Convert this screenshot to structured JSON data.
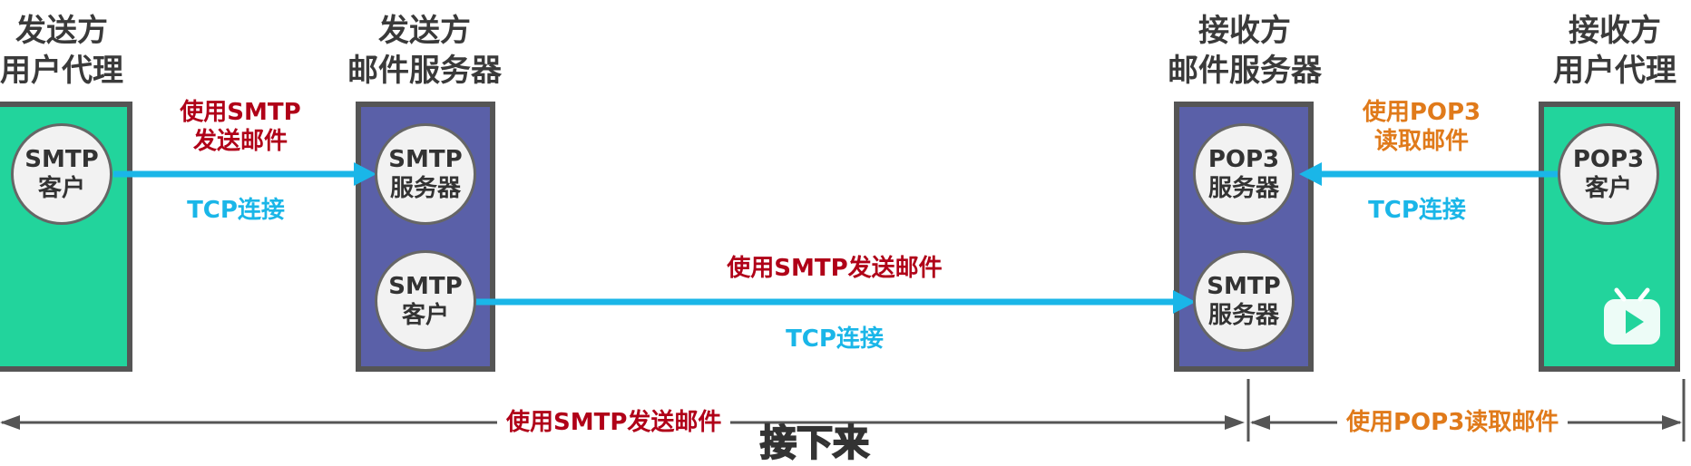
{
  "colors": {
    "agent_fill": "#22d49c",
    "server_fill": "#5a60a8",
    "arrow": "#1ab6e8",
    "smtp_text": "#b00018",
    "pop3_text": "#e07a1a"
  },
  "entities": {
    "sender_agent": {
      "line1": "发送方",
      "line2": "用户代理",
      "node": [
        "SMTP",
        "客户"
      ]
    },
    "sender_server": {
      "line1": "发送方",
      "line2": "邮件服务器",
      "node_top": [
        "SMTP",
        "服务器"
      ],
      "node_bottom": [
        "SMTP",
        "客户"
      ]
    },
    "receiver_server": {
      "line1": "接收方",
      "line2": "邮件服务器",
      "node_top": [
        "POP3",
        "服务器"
      ],
      "node_bottom": [
        "SMTP",
        "服务器"
      ]
    },
    "receiver_agent": {
      "line1": "接收方",
      "line2": "用户代理",
      "node": [
        "POP3",
        "客户"
      ]
    }
  },
  "links": {
    "agent_to_server": {
      "line1": "使用SMTP",
      "line2": "发送邮件",
      "tcp": "TCP连接"
    },
    "server_to_server": {
      "label": "使用SMTP发送邮件",
      "tcp": "TCP连接"
    },
    "pop3_read": {
      "line1": "使用POP3",
      "line2": "读取邮件",
      "tcp": "TCP连接"
    }
  },
  "bottom": {
    "smtp_span": "使用SMTP发送邮件",
    "pop3_span": "使用POP3读取邮件"
  },
  "subtitle": "接下来",
  "overlay": {
    "play_icon": "play-icon"
  }
}
